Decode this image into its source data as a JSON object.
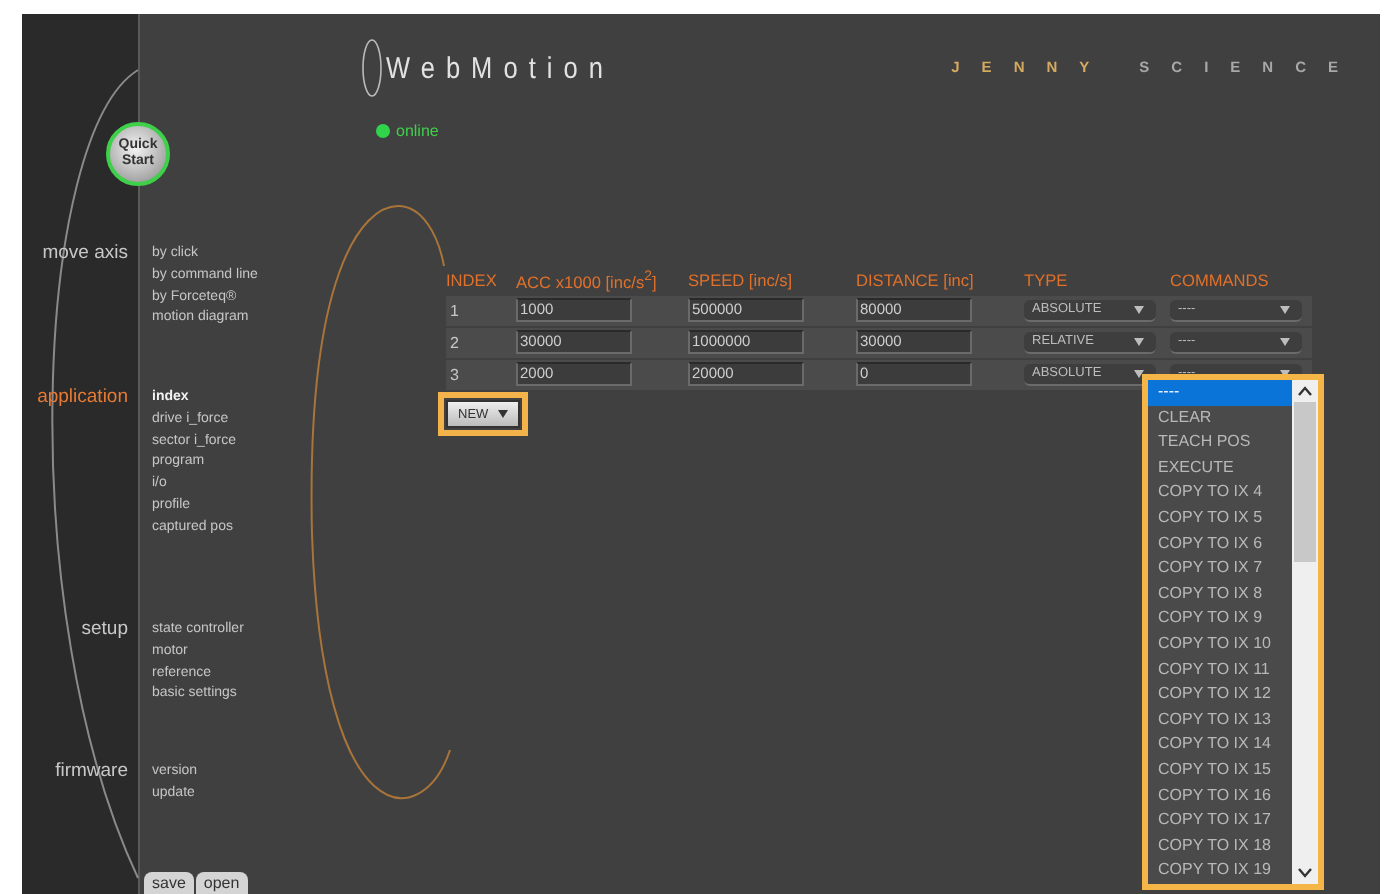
{
  "header": {
    "logo": "WebMotion",
    "brand": [
      "JENNY",
      "SCIENCE"
    ]
  },
  "quick_start": "Quick Start",
  "status": {
    "label": "online",
    "connected": true
  },
  "sidebar": {
    "sections": [
      {
        "label": "move axis",
        "selected": false,
        "items": [
          {
            "label": "by click",
            "selected": false
          },
          {
            "label": "by command line",
            "selected": false
          },
          {
            "label": "by Forceteq®",
            "selected": false
          },
          {
            "label": "motion diagram",
            "selected": false
          }
        ]
      },
      {
        "label": "application",
        "selected": true,
        "items": [
          {
            "label": "index",
            "selected": true
          },
          {
            "label": "drive i_force",
            "selected": false
          },
          {
            "label": "sector i_force",
            "selected": false
          },
          {
            "label": "program",
            "selected": false
          },
          {
            "label": "i/o",
            "selected": false
          },
          {
            "label": "profile",
            "selected": false
          },
          {
            "label": "captured pos",
            "selected": false
          }
        ]
      },
      {
        "label": "setup",
        "selected": false,
        "items": [
          {
            "label": "state controller",
            "selected": false
          },
          {
            "label": "motor",
            "selected": false
          },
          {
            "label": "reference",
            "selected": false
          },
          {
            "label": "basic settings",
            "selected": false
          }
        ]
      },
      {
        "label": "firmware",
        "selected": false,
        "items": [
          {
            "label": "version",
            "selected": false
          },
          {
            "label": "update",
            "selected": false
          }
        ]
      }
    ],
    "buttons": [
      "save",
      "open"
    ]
  },
  "table": {
    "columns": [
      "INDEX",
      "ACC x1000 [inc/s$^{2}$]",
      "SPEED [inc/s]",
      "DISTANCE [inc]",
      "TYPE",
      "COMMANDS"
    ],
    "rows": [
      {
        "index": "1",
        "acc": "1000",
        "speed": "500000",
        "distance": "80000",
        "type": "ABSOLUTE",
        "command": "----"
      },
      {
        "index": "2",
        "acc": "30000",
        "speed": "1000000",
        "distance": "30000",
        "type": "RELATIVE",
        "command": "----"
      },
      {
        "index": "3",
        "acc": "2000",
        "speed": "20000",
        "distance": "0",
        "type": "ABSOLUTE",
        "command": "----"
      }
    ]
  },
  "new_button": "NEW",
  "dropdown": {
    "options": [
      {
        "label": "----",
        "selected": true
      },
      {
        "label": "CLEAR",
        "selected": false
      },
      {
        "label": "TEACH POS",
        "selected": false
      },
      {
        "label": "EXECUTE",
        "selected": false
      },
      {
        "label": "COPY TO IX 4",
        "selected": false
      },
      {
        "label": "COPY TO IX 5",
        "selected": false
      },
      {
        "label": "COPY TO IX 6",
        "selected": false
      },
      {
        "label": "COPY TO IX 7",
        "selected": false
      },
      {
        "label": "COPY TO IX 8",
        "selected": false
      },
      {
        "label": "COPY TO IX 9",
        "selected": false
      },
      {
        "label": "COPY TO IX 10",
        "selected": false
      },
      {
        "label": "COPY TO IX 11",
        "selected": false
      },
      {
        "label": "COPY TO IX 12",
        "selected": false
      },
      {
        "label": "COPY TO IX 13",
        "selected": false
      },
      {
        "label": "COPY TO IX 14",
        "selected": false
      },
      {
        "label": "COPY TO IX 15",
        "selected": false
      },
      {
        "label": "COPY TO IX 16",
        "selected": false
      },
      {
        "label": "COPY TO IX 17",
        "selected": false
      },
      {
        "label": "COPY TO IX 18",
        "selected": false
      },
      {
        "label": "COPY TO IX 19",
        "selected": false
      }
    ]
  }
}
